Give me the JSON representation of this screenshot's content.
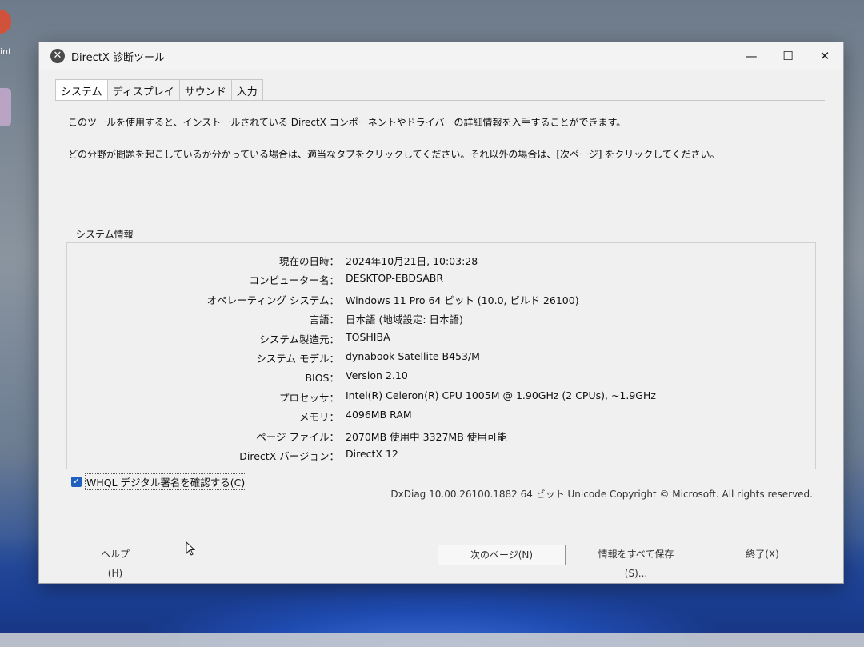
{
  "desktop": {
    "partial_label": "int"
  },
  "window": {
    "title": "DirectX 診断ツール",
    "controls": {
      "minimize": "—",
      "maximize": "☐",
      "close": "✕"
    }
  },
  "tabs": [
    {
      "label": "システム",
      "active": true
    },
    {
      "label": "ディスプレイ"
    },
    {
      "label": "サウンド"
    },
    {
      "label": "入力"
    }
  ],
  "intro": {
    "line1": "このツールを使用すると、インストールされている DirectX コンポーネントやドライバーの詳細情報を入手することができます。",
    "line2": "どの分野が問題を起こしているか分かっている場合は、適当なタブをクリックしてください。それ以外の場合は、[次ページ] をクリックしてください。"
  },
  "system_info": {
    "title": "システム情報",
    "rows": [
      {
        "label": "現在の日時：",
        "value": "2024年10月21日, 10:03:28"
      },
      {
        "label": "コンピューター名：",
        "value": "DESKTOP-EBDSABR"
      },
      {
        "label": "オペレーティング システム：",
        "value": "Windows 11 Pro 64 ビット (10.0, ビルド 26100)"
      },
      {
        "label": "言語：",
        "value": "日本語 (地域設定: 日本語)"
      },
      {
        "label": "システム製造元：",
        "value": "TOSHIBA"
      },
      {
        "label": "システム モデル：",
        "value": "dynabook Satellite B453/M"
      },
      {
        "label": "BIOS：",
        "value": "Version 2.10"
      },
      {
        "label": "プロセッサ：",
        "value": "Intel(R) Celeron(R) CPU 1005M @ 1.90GHz (2 CPUs), ~1.9GHz"
      },
      {
        "label": "メモリ：",
        "value": "4096MB RAM"
      },
      {
        "label": "ページ ファイル：",
        "value": "2070MB 使用中 3327MB 使用可能"
      },
      {
        "label": "DirectX バージョン：",
        "value": "DirectX 12"
      }
    ]
  },
  "whql": {
    "label": "WHQL デジタル署名を確認する(C)",
    "checked": true
  },
  "copyright": "DxDiag 10.00.26100.1882 64 ビット Unicode  Copyright © Microsoft. All rights reserved.",
  "buttons": {
    "help": "ヘルプ(H)",
    "next": "次のページ(N)",
    "save": "情報をすべて保存(S)...",
    "exit": "終了(X)"
  }
}
